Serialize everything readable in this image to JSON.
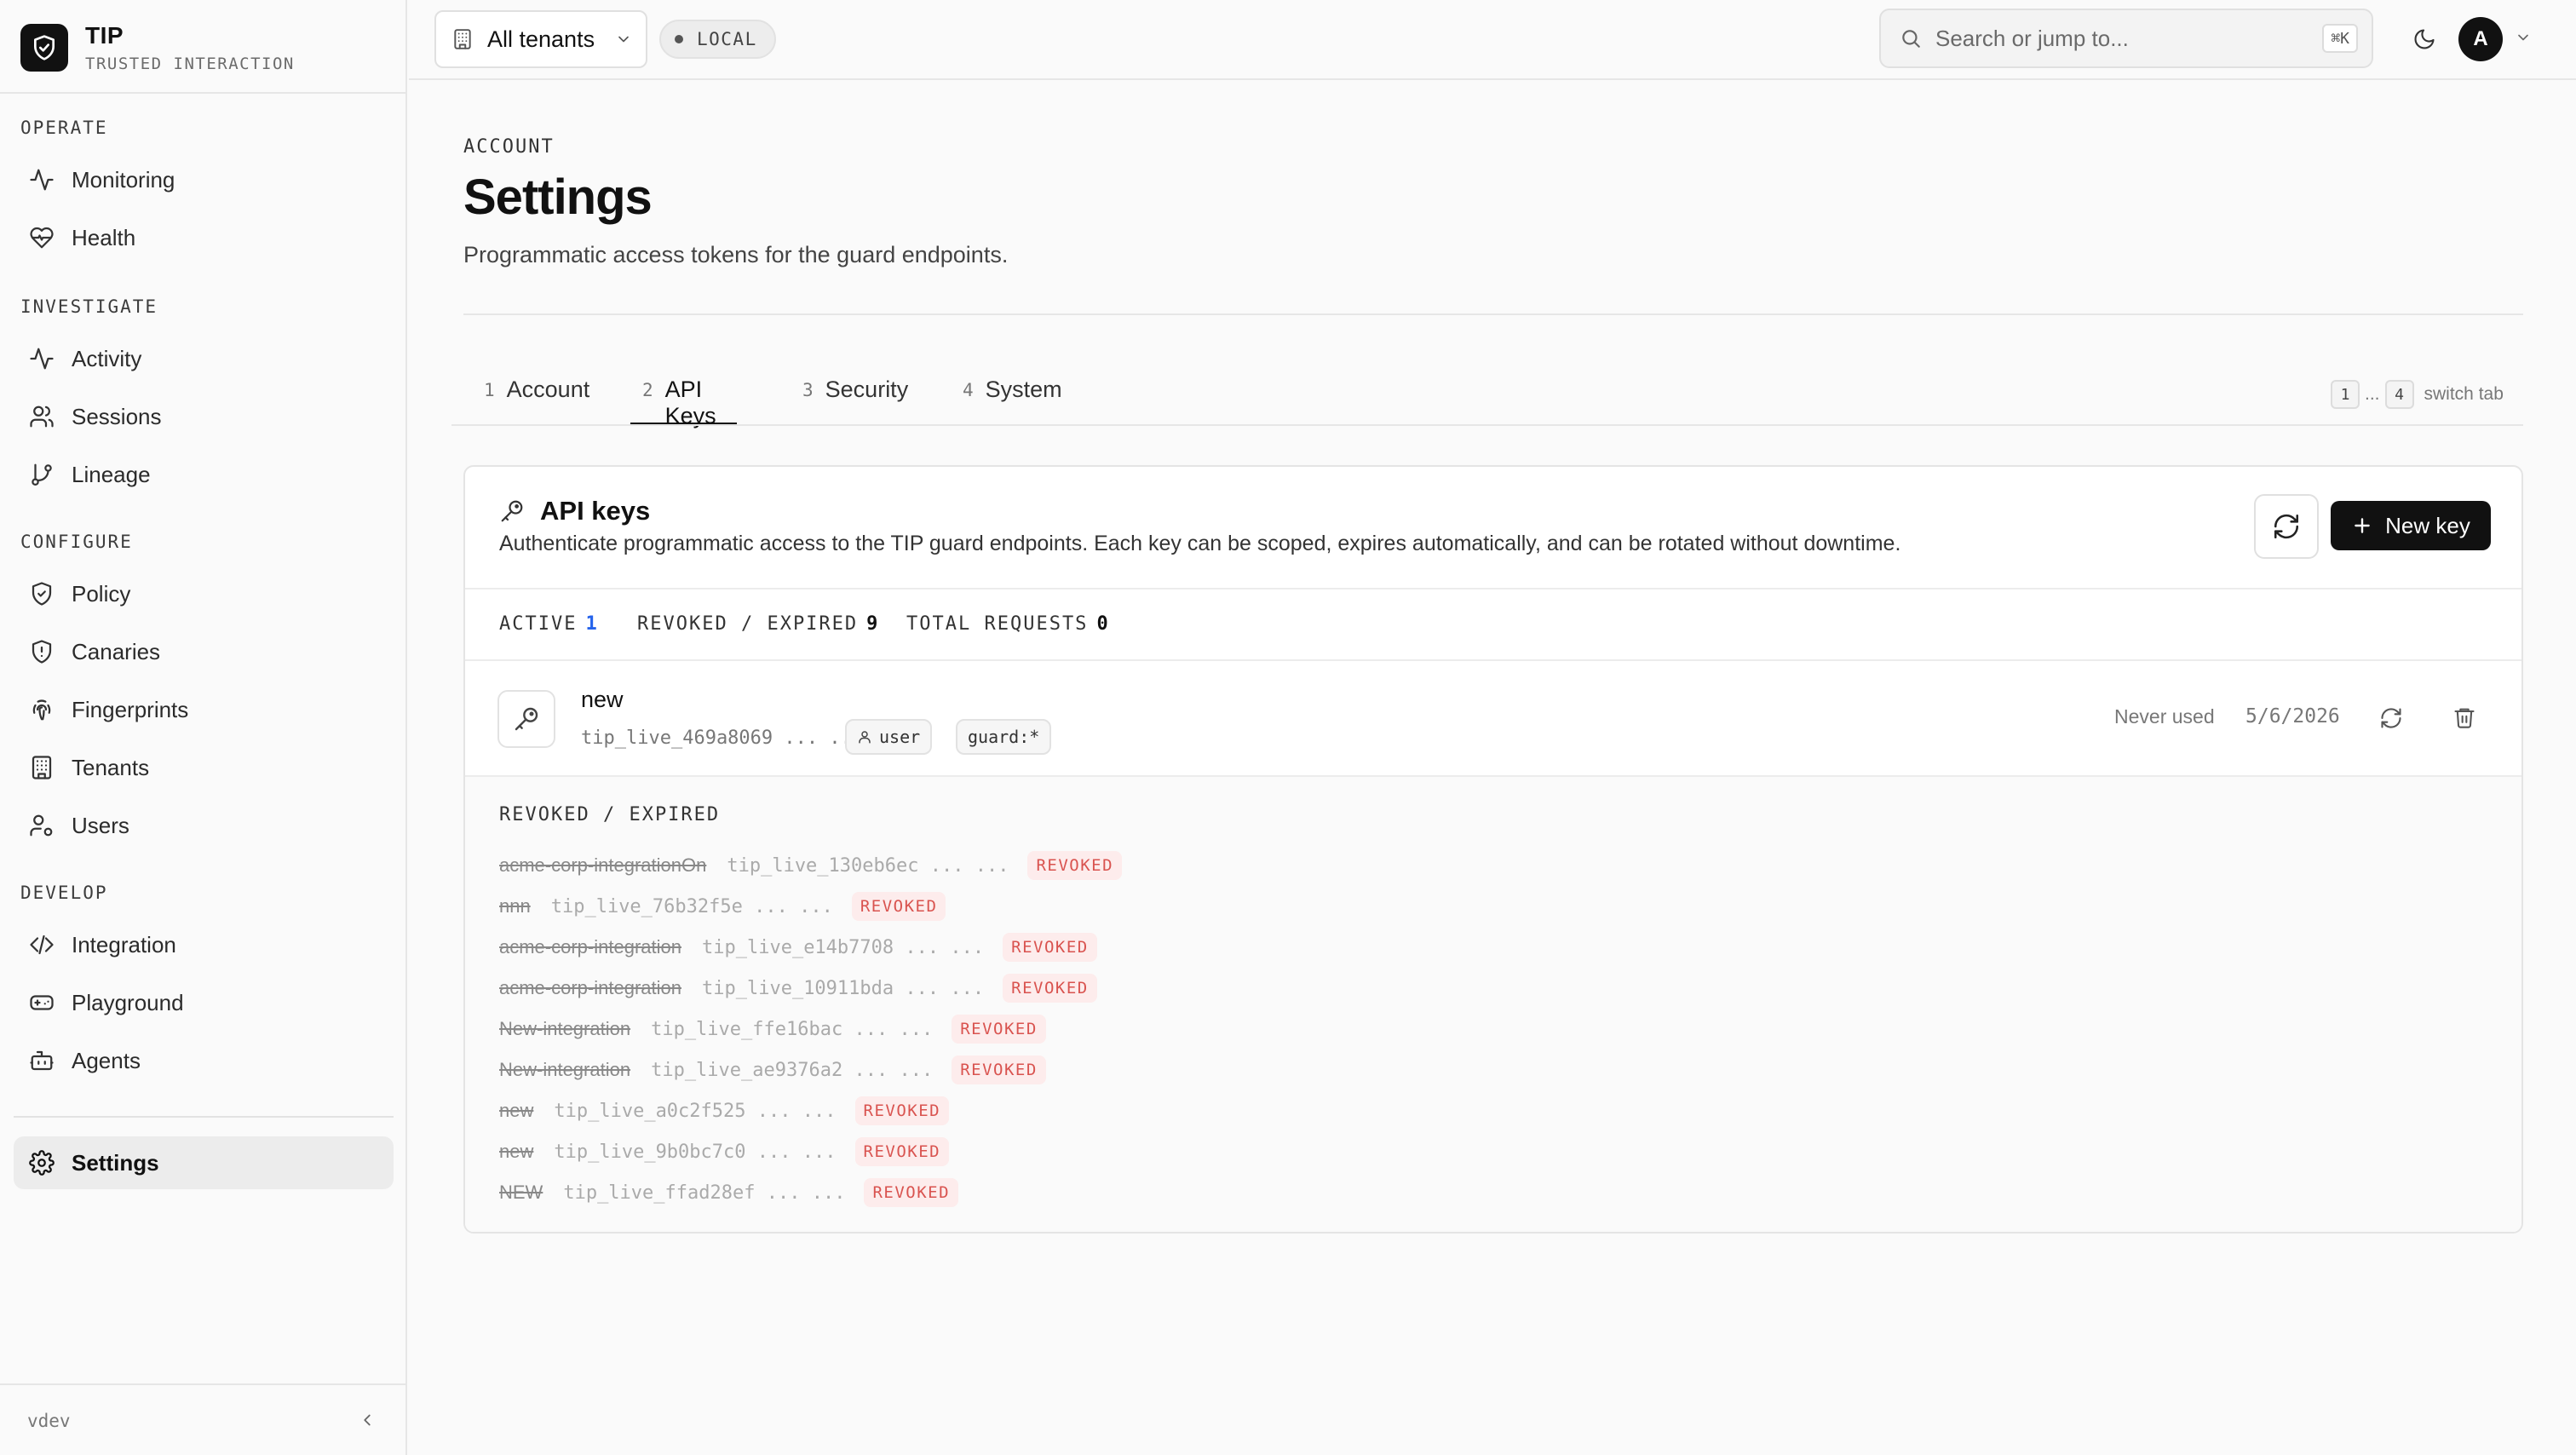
{
  "brand": {
    "name": "TIP",
    "subtitle": "TRUSTED INTERACTION"
  },
  "sidebar": {
    "sections": [
      {
        "title": "OPERATE",
        "items": [
          {
            "label": "Monitoring",
            "icon": "activity-icon"
          },
          {
            "label": "Health",
            "icon": "heart-pulse-icon"
          }
        ]
      },
      {
        "title": "INVESTIGATE",
        "items": [
          {
            "label": "Activity",
            "icon": "activity-icon"
          },
          {
            "label": "Sessions",
            "icon": "users-icon"
          },
          {
            "label": "Lineage",
            "icon": "git-branch-icon"
          }
        ]
      },
      {
        "title": "CONFIGURE",
        "items": [
          {
            "label": "Policy",
            "icon": "shield-check-icon"
          },
          {
            "label": "Canaries",
            "icon": "shield-alert-icon"
          },
          {
            "label": "Fingerprints",
            "icon": "fingerprint-icon"
          },
          {
            "label": "Tenants",
            "icon": "building-icon"
          },
          {
            "label": "Users",
            "icon": "user-cog-icon"
          }
        ]
      },
      {
        "title": "DEVELOP",
        "items": [
          {
            "label": "Integration",
            "icon": "code-icon"
          },
          {
            "label": "Playground",
            "icon": "gamepad-icon"
          },
          {
            "label": "Agents",
            "icon": "bot-icon"
          }
        ]
      }
    ],
    "settings_label": "Settings",
    "version": "vdev"
  },
  "topbar": {
    "tenant_label": "All tenants",
    "env_badge": "LOCAL",
    "search_placeholder": "Search or jump to...",
    "search_shortcut": "⌘K",
    "avatar_initial": "A"
  },
  "page": {
    "eyebrow": "ACCOUNT",
    "title": "Settings",
    "subtitle": "Programmatic access tokens for the guard endpoints."
  },
  "tabs": [
    {
      "num": "1",
      "label": "Account"
    },
    {
      "num": "2",
      "label": "API Keys"
    },
    {
      "num": "3",
      "label": "Security"
    },
    {
      "num": "4",
      "label": "System"
    }
  ],
  "active_tab": "API Keys",
  "switch_hint": {
    "from": "1",
    "dots": "...",
    "to": "4",
    "text": "switch tab"
  },
  "api_keys": {
    "title": "API keys",
    "description": "Authenticate programmatic access to the TIP guard endpoints. Each key can be scoped, expires automatically, and can be rotated without downtime.",
    "new_key_label": "New key",
    "stats": {
      "active_label": "ACTIVE",
      "active_value": "1",
      "revoked_label": "REVOKED / EXPIRED",
      "revoked_value": "9",
      "requests_label": "TOTAL REQUESTS",
      "requests_value": "0"
    },
    "active_key": {
      "name": "new",
      "prefix": "tip_live_469a8069 ... ...",
      "role": "user",
      "scope": "guard:*",
      "last_used": "Never used",
      "created": "5/6/2026"
    },
    "revoked_title": "REVOKED / EXPIRED",
    "revoked_badge": "REVOKED",
    "revoked": [
      {
        "name": "acme-corp-integrationOn",
        "prefix": "tip_live_130eb6ec ... ..."
      },
      {
        "name": "nnn",
        "prefix": "tip_live_76b32f5e ... ..."
      },
      {
        "name": "acme-corp-integration",
        "prefix": "tip_live_e14b7708 ... ..."
      },
      {
        "name": "acme-corp-integration",
        "prefix": "tip_live_10911bda ... ..."
      },
      {
        "name": "New-integration",
        "prefix": "tip_live_ffe16bac ... ..."
      },
      {
        "name": "New-integration",
        "prefix": "tip_live_ae9376a2 ... ..."
      },
      {
        "name": "new",
        "prefix": "tip_live_a0c2f525 ... ..."
      },
      {
        "name": "new",
        "prefix": "tip_live_9b0bc7c0 ... ..."
      },
      {
        "name": "NEW",
        "prefix": "tip_live_ffad28ef ... ..."
      }
    ]
  },
  "colors": {
    "accent": "#111111",
    "link_blue": "#2563eb",
    "revoked_red": "#d9534f",
    "revoked_bg": "#fdecec"
  }
}
